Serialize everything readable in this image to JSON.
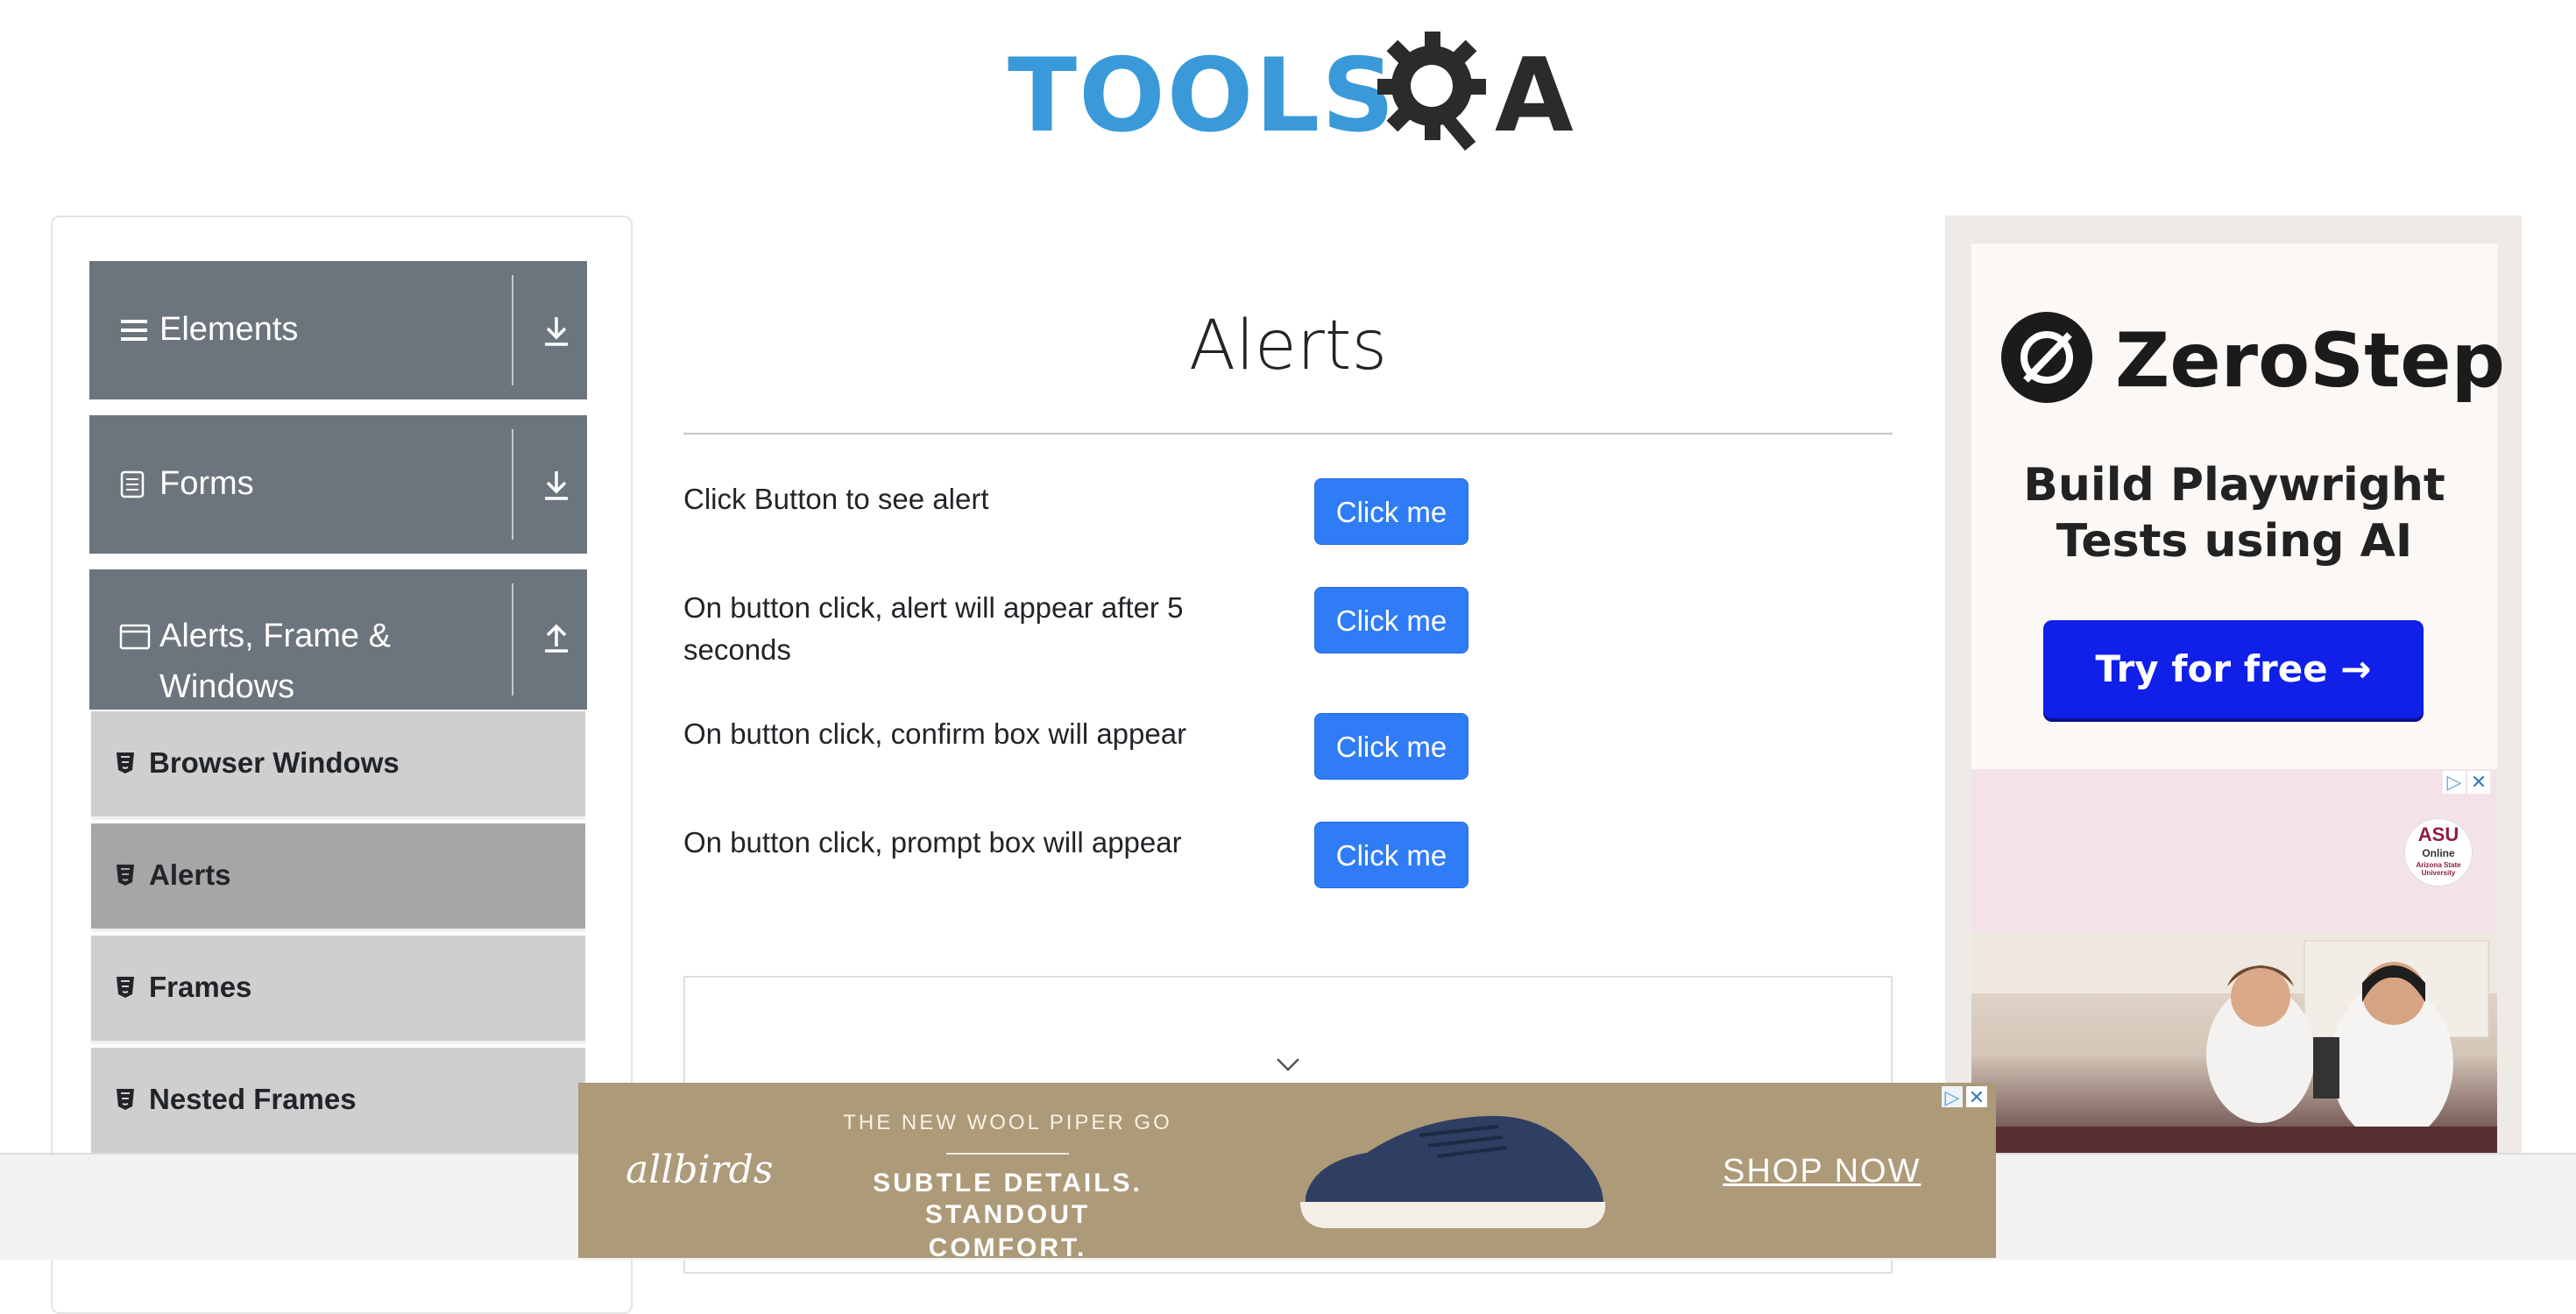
{
  "header": {
    "logo_tools": "TOOLS",
    "logo_qa": "A"
  },
  "sidebar": {
    "groups": [
      {
        "label": "Elements"
      },
      {
        "label": "Forms"
      },
      {
        "label": "Alerts, Frame & Windows",
        "label_line1": "Alerts, Frame &",
        "label_line2": "Windows"
      }
    ],
    "items": [
      {
        "label": "Browser Windows"
      },
      {
        "label": "Alerts"
      },
      {
        "label": "Frames"
      },
      {
        "label": "Nested Frames"
      }
    ],
    "active_item": "Alerts"
  },
  "main": {
    "title": "Alerts",
    "rows": [
      {
        "text": "Click Button to see alert",
        "button": "Click me"
      },
      {
        "text": "On button click, alert will appear after 5 seconds",
        "button": "Click me"
      },
      {
        "text": "On button click, confirm box will appear",
        "button": "Click me"
      },
      {
        "text": "On button click, prompt box will appear",
        "button": "Click me"
      }
    ]
  },
  "ad_right": {
    "brand": "ZeroStep",
    "tagline_1": "Build Playwright",
    "tagline_2": "Tests using AI",
    "cta": "Try for free →",
    "asu_line1": "ASU",
    "asu_line2": "Online",
    "asu_line3": "Arizona State University"
  },
  "ad_bottom": {
    "brand": "allbirds",
    "subtitle": "THE NEW WOOL PIPER GO",
    "headline_1": "SUBTLE DETAILS.",
    "headline_2": "STANDOUT COMFORT.",
    "cta": "SHOP NOW"
  },
  "colors": {
    "primary_button": "#2f7cf6",
    "sidebar_header": "#6c757d",
    "active_item": "#a6a6a6",
    "logo_blue": "#3a9ad9"
  },
  "icons": [
    "menu-icon",
    "form-icon",
    "window-icon",
    "download-icon",
    "upload-icon",
    "html5-icon",
    "chevron-down-icon",
    "close-icon",
    "adchoices-icon"
  ]
}
